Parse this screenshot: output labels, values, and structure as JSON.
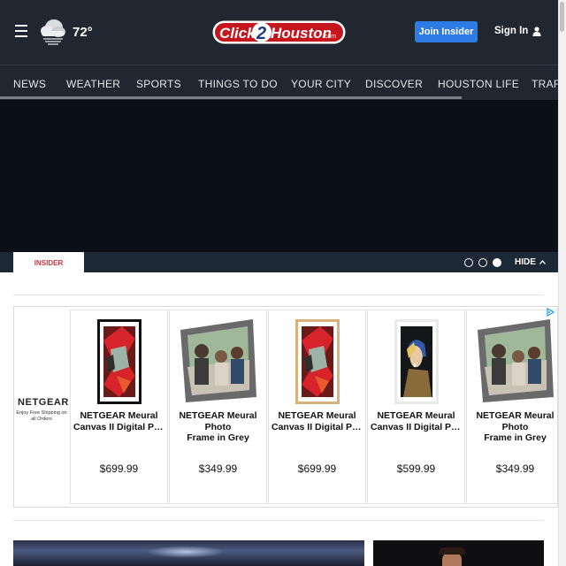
{
  "header": {
    "temperature": "72°",
    "weather_icon": "cloud-rain-icon",
    "logo": {
      "part1": "Click",
      "part2": "2",
      "part3": "Houston",
      "suffix": ".com"
    },
    "join_label": "Join Insider",
    "signin_label": "Sign In",
    "colors": {
      "bg": "#212731",
      "join": "#2d7be5",
      "logo_red": "#c4161c"
    }
  },
  "nav": {
    "items": [
      "NEWS",
      "WEATHER",
      "SPORTS",
      "THINGS TO DO",
      "YOUR CITY",
      "DISCOVER",
      "HOUSTON LIFE",
      "TRAFF"
    ]
  },
  "insider_bar": {
    "tab_label": "INSIDER",
    "hide_label": "HIDE",
    "slide_count": 3,
    "active_slide": 3
  },
  "ad": {
    "brand": "NETGEAR",
    "brand_tagline": "Enjoy Free Shipping on all Orders",
    "products": [
      {
        "title_line1": "NETGEAR Meural",
        "title_line2": "Canvas II Digital Phot…",
        "price": "$699.99",
        "image": "red-abstract-painting-black-frame"
      },
      {
        "title_line1": "NETGEAR Meural Photo",
        "title_line2": "Frame in Grey",
        "price": "$349.99",
        "image": "family-photo-grey-frame"
      },
      {
        "title_line1": "NETGEAR Meural",
        "title_line2": "Canvas II Digital Phot…",
        "price": "$699.99",
        "image": "red-abstract-painting-wood-frame"
      },
      {
        "title_line1": "NETGEAR Meural",
        "title_line2": "Canvas II Digital Phot…",
        "price": "$599.99",
        "image": "pearl-earring-portrait-white-frame"
      },
      {
        "title_line1": "NETGEAR Meural Photo",
        "title_line2": "Frame in Grey",
        "price": "$349.99",
        "image": "family-photo-grey-frame"
      }
    ]
  }
}
